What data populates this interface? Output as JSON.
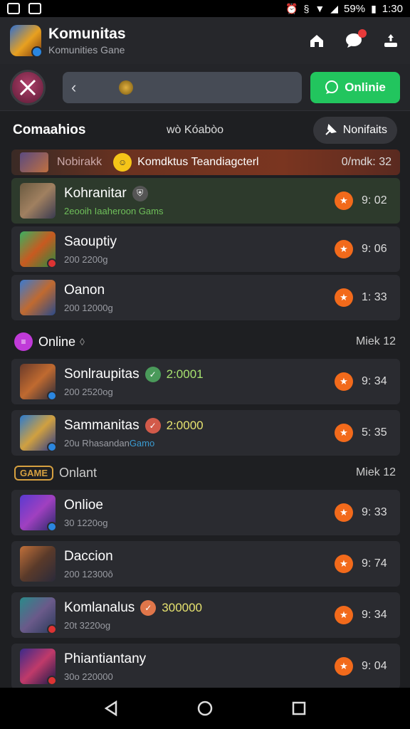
{
  "status": {
    "battery": "59%",
    "time": "1:30"
  },
  "header": {
    "title": "Komunitas",
    "subtitle": "Komunities Gane"
  },
  "search": {
    "online_label": "Onlinie"
  },
  "filter": {
    "title": "Comaahios",
    "center": "wò Kóabòo",
    "notif_label": "Nonifaits"
  },
  "banner": {
    "label": "Nobirakk",
    "text": "Komdktus Teandiagcterl",
    "right": "0/mdk: 32"
  },
  "items": [
    {
      "title": "Kohranitar",
      "sub": "2eooih Iaaheroon Gams",
      "time": "9: 02"
    },
    {
      "title": "Saouptiy",
      "sub": "200 2200g",
      "time": "9: 06"
    },
    {
      "title": "Oanon",
      "sub": "200 12000g",
      "time": "1: 33"
    }
  ],
  "section1": {
    "title": "Online",
    "right": "Miek 12"
  },
  "items2": [
    {
      "title": "Sonlraupitas",
      "points": "2:0001",
      "sub": "200 2520og",
      "time": "9: 34"
    },
    {
      "title": "Sammanitas",
      "points": "2:0000",
      "sub": "20u Rhasandan",
      "sub2": "Gamo",
      "time": "5: 35"
    }
  ],
  "section2": {
    "tag": "GAME",
    "title": "Onlant",
    "right": "Miek 12"
  },
  "items3": [
    {
      "title": "Onlioe",
      "sub": "30 1220og",
      "time": "9: 33"
    },
    {
      "title": "Daccion",
      "sub": "200 12300ô",
      "time": "9: 74"
    },
    {
      "title": "Komlanalus",
      "points": "300000",
      "sub": "20t 3220og",
      "time": "9: 34"
    },
    {
      "title": "Phiantiantany",
      "sub": "30o 220000",
      "time": "9: 04"
    }
  ]
}
